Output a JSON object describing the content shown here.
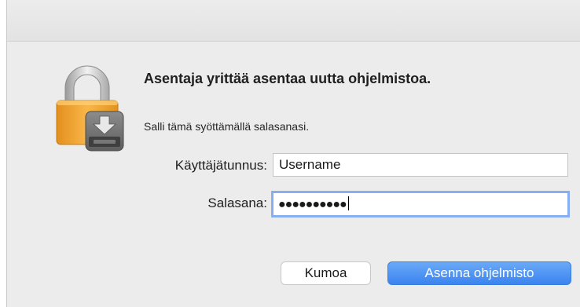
{
  "dialog": {
    "title": "Asentaja yrittää asentaa uutta ohjelmistoa.",
    "message": "Salli tämä syöttämällä salasanasi.",
    "icon": "lock-installer-icon"
  },
  "form": {
    "username_label": "Käyttäjätunnus:",
    "username_value": "Username",
    "password_label": "Salasana:",
    "password_value": "●●●●●●●●●●"
  },
  "buttons": {
    "cancel_label": "Kumoa",
    "install_label": "Asenna ohjelmisto"
  },
  "colors": {
    "accent": "#3b84f0",
    "lock_body": "#f0a73a",
    "lock_shackle": "#c8c8c8",
    "focus_ring": "#87aef0"
  }
}
